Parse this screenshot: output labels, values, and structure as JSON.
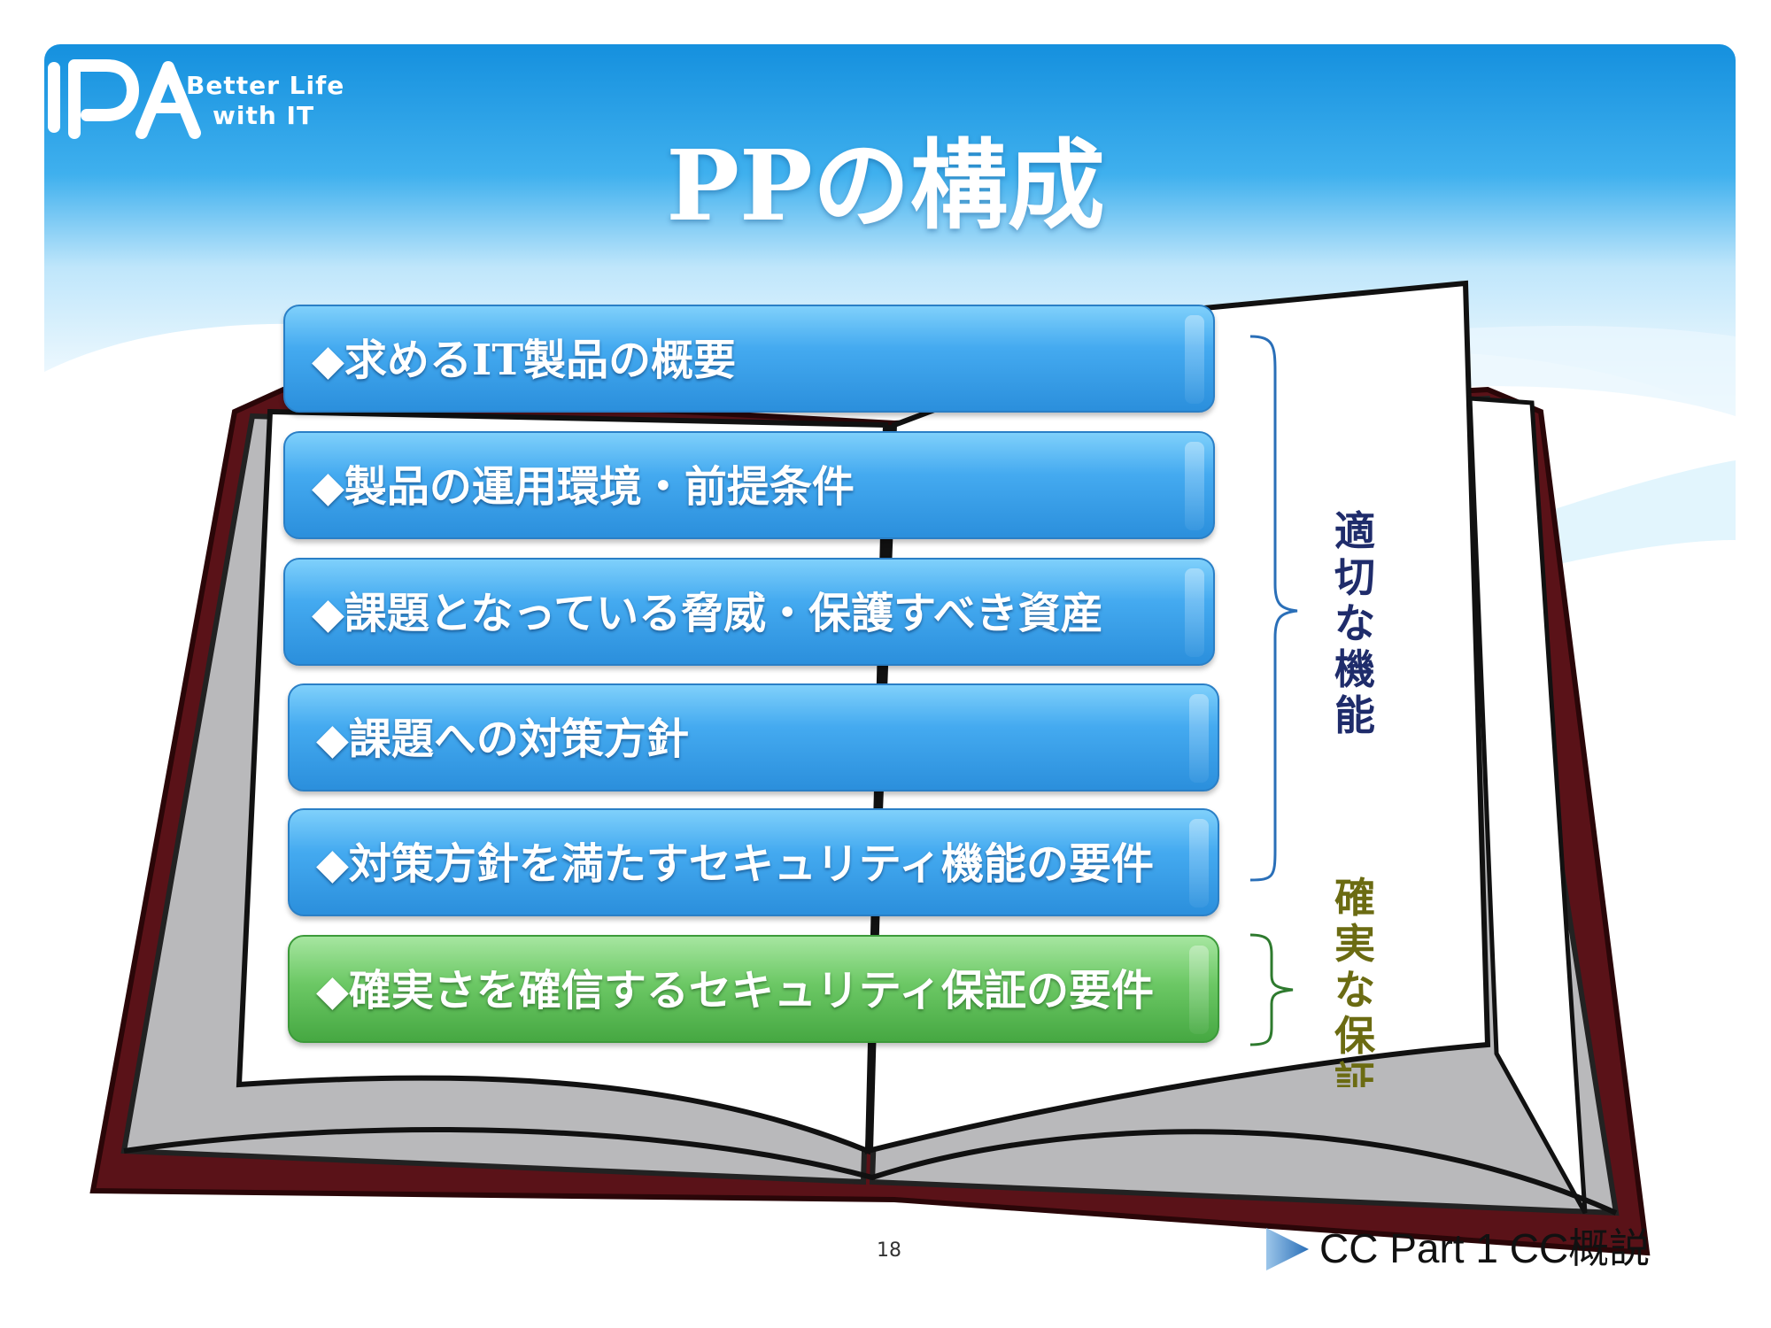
{
  "logo": {
    "mark": "IPA",
    "tagline_line1": "Better Life",
    "tagline_line2": "with IT"
  },
  "title": "PPの構成",
  "items": [
    {
      "label": "◆求めるIT製品の概要",
      "color": "blue"
    },
    {
      "label": "◆製品の運用環境・前提条件",
      "color": "blue"
    },
    {
      "label": "◆課題となっている脅威・保護すべき資産",
      "color": "blue"
    },
    {
      "label": "◆課題への対策方針",
      "color": "blue"
    },
    {
      "label": "◆対策方針を満たすセキュリティ機能の要件",
      "color": "blue"
    },
    {
      "label": "◆確実さを確信するセキュリティ保証の要件",
      "color": "green"
    }
  ],
  "brackets": {
    "functions": "適切な機能",
    "assurance": "確実な保証"
  },
  "colors": {
    "blue_bar": "#44aaf0",
    "green_bar": "#6cc865",
    "functions_text": "#1f2c6b",
    "assurance_text": "#6b6b12",
    "header_blue": "#1a9ae3"
  },
  "page_number": "18",
  "footer": "CC Part 1 CC概説"
}
